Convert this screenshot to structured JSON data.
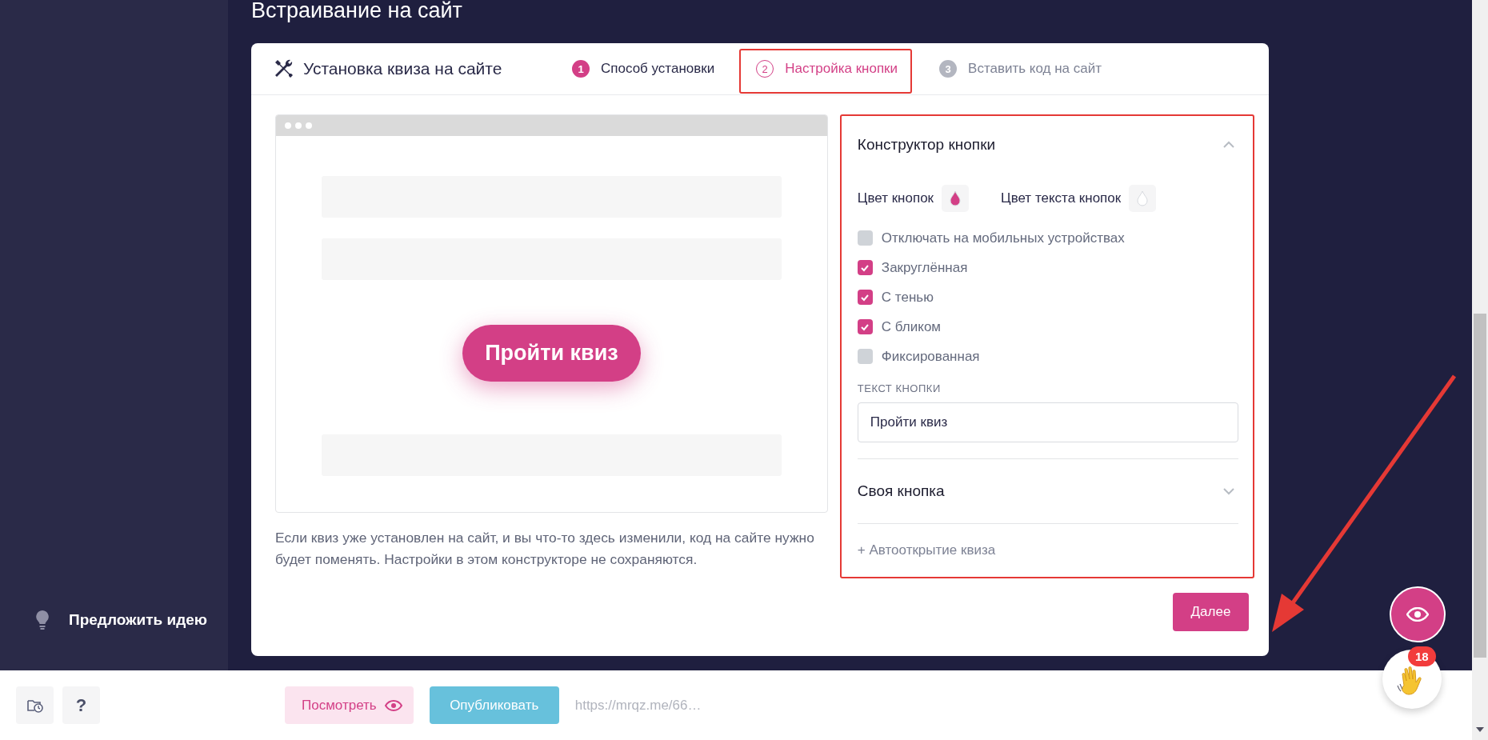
{
  "sidebar": {
    "suggest": "Предложить идею"
  },
  "page_title": "Встраивание на сайт",
  "card": {
    "title": "Установка квиза на сайте",
    "steps": [
      {
        "number": "1",
        "label": "Способ установки",
        "done": true,
        "selected": false
      },
      {
        "number": "2",
        "label": "Настройка кнопки",
        "done": false,
        "selected": true
      },
      {
        "number": "3",
        "label": "Вставить код на сайт",
        "done": false,
        "selected": false
      }
    ]
  },
  "preview": {
    "button_text": "Пройти квиз",
    "note": "Если квиз уже установлен на сайт, и вы что-то здесь изменили, код на сайте нужно будет поменять. Настройки в этом конструкторе не сохраняются."
  },
  "constructor": {
    "title": "Конструктор кнопки",
    "expanded": true,
    "colors": [
      {
        "label": "Цвет кнопок",
        "color": "#d33f86"
      },
      {
        "label": "Цвет текста кнопок",
        "color": "#ffffff"
      }
    ],
    "options": [
      {
        "label": "Отключать на мобильных устройствах",
        "checked": false
      },
      {
        "label": "Закруглённая",
        "checked": true
      },
      {
        "label": "С тенью",
        "checked": true
      },
      {
        "label": "С бликом",
        "checked": true
      },
      {
        "label": "Фиксированная",
        "checked": false
      }
    ],
    "field_label": "ТЕКСТ КНОПКИ",
    "field_value": "Пройти квиз"
  },
  "custom": {
    "title": "Своя кнопка",
    "expanded": false
  },
  "autoopen_link": "+ Автооткрытие квиза",
  "next_button": "Далее",
  "bottom_bar": {
    "help": "?",
    "preview_button": "Посмотреть",
    "publish_button": "Опубликовать",
    "url": "https://mrqz.me/66…"
  },
  "chat": {
    "badge": "18"
  }
}
